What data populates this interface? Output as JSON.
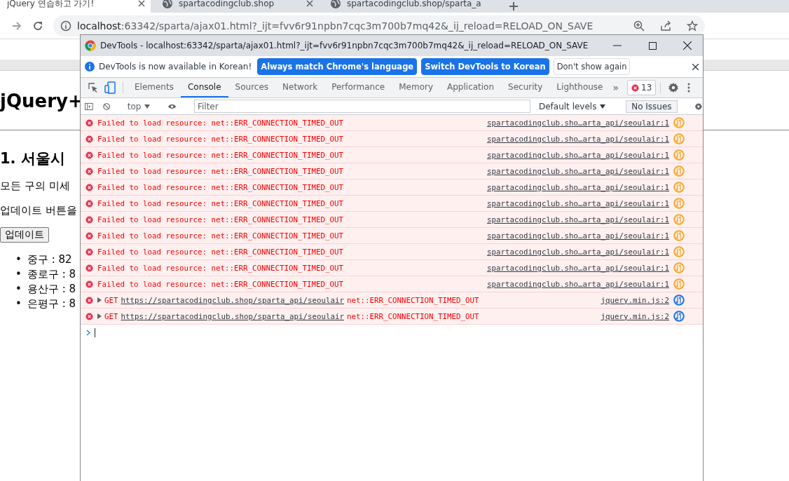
{
  "browser": {
    "tabs": [
      {
        "title": "jQuery 연습하고 가기!",
        "selected": true
      },
      {
        "title": "spartacodingclub.shop",
        "selected": false
      },
      {
        "title": "spartacodingclub.shop/sparta_a",
        "selected": false
      }
    ],
    "address": {
      "host": "localhost",
      "rest": ":63342/sparta/ajax01.html?_ijt=fvv6r91npbn7cqc3m700b7mq42&_ij_reload=RELOAD_ON_SAVE"
    }
  },
  "page": {
    "heading": "jQuery+",
    "subheading": "1. 서울시",
    "paragraphs": [
      "모든 구의 미세",
      "업데이트 버튼을"
    ],
    "button": "업데이트",
    "items": [
      {
        "marker": "•",
        "text": "중구 : 82"
      },
      {
        "marker": "•",
        "text": "종로구 : 8"
      },
      {
        "marker": "•",
        "text": "용산구 : 8"
      },
      {
        "marker": "•",
        "text": "은평구 : 8"
      }
    ]
  },
  "devtools": {
    "title": "DevTools - localhost:63342/sparta/ajax01.html?_ijt=fvv6r91npbn7cqc3m700b7mq42&_ij_reload=RELOAD_ON_SAVE",
    "infobar": {
      "message": "DevTools is now available in Korean!",
      "buttons": [
        {
          "label": "Always match Chrome's language",
          "kind": "primary"
        },
        {
          "label": "Switch DevTools to Korean",
          "kind": "primary"
        },
        {
          "label": "Don't show again",
          "kind": "secondary"
        }
      ]
    },
    "tabs": [
      {
        "label": "Elements",
        "selected": false
      },
      {
        "label": "Console",
        "selected": true
      },
      {
        "label": "Sources",
        "selected": false
      },
      {
        "label": "Network",
        "selected": false
      },
      {
        "label": "Performance",
        "selected": false
      },
      {
        "label": "Memory",
        "selected": false
      },
      {
        "label": "Application",
        "selected": false
      },
      {
        "label": "Security",
        "selected": false
      },
      {
        "label": "Lighthouse",
        "selected": false
      }
    ],
    "more_tabs": "»",
    "error_count": "13",
    "toolbar": {
      "context": "top",
      "filter_placeholder": "Filter",
      "levels": "Default levels",
      "issues": "No Issues"
    },
    "messages": [
      {
        "kind": "failed",
        "text": "Failed to load resource: net::ERR_CONNECTION_TIMED_OUT",
        "source": "spartacodingclub.sho…arta_api/seoulair:1",
        "color": "#f9a825"
      },
      {
        "kind": "failed",
        "text": "Failed to load resource: net::ERR_CONNECTION_TIMED_OUT",
        "source": "spartacodingclub.sho…arta_api/seoulair:1",
        "color": "#f9a825"
      },
      {
        "kind": "failed",
        "text": "Failed to load resource: net::ERR_CONNECTION_TIMED_OUT",
        "source": "spartacodingclub.sho…arta_api/seoulair:1",
        "color": "#f9a825"
      },
      {
        "kind": "failed",
        "text": "Failed to load resource: net::ERR_CONNECTION_TIMED_OUT",
        "source": "spartacodingclub.sho…arta_api/seoulair:1",
        "color": "#f9a825"
      },
      {
        "kind": "failed",
        "text": "Failed to load resource: net::ERR_CONNECTION_TIMED_OUT",
        "source": "spartacodingclub.sho…arta_api/seoulair:1",
        "color": "#f9a825"
      },
      {
        "kind": "failed",
        "text": "Failed to load resource: net::ERR_CONNECTION_TIMED_OUT",
        "source": "spartacodingclub.sho…arta_api/seoulair:1",
        "color": "#f9a825"
      },
      {
        "kind": "failed",
        "text": "Failed to load resource: net::ERR_CONNECTION_TIMED_OUT",
        "source": "spartacodingclub.sho…arta_api/seoulair:1",
        "color": "#f9a825"
      },
      {
        "kind": "failed",
        "text": "Failed to load resource: net::ERR_CONNECTION_TIMED_OUT",
        "source": "spartacodingclub.sho…arta_api/seoulair:1",
        "color": "#f9a825"
      },
      {
        "kind": "failed",
        "text": "Failed to load resource: net::ERR_CONNECTION_TIMED_OUT",
        "source": "spartacodingclub.sho…arta_api/seoulair:1",
        "color": "#f9a825"
      },
      {
        "kind": "failed",
        "text": "Failed to load resource: net::ERR_CONNECTION_TIMED_OUT",
        "source": "spartacodingclub.sho…arta_api/seoulair:1",
        "color": "#f9a825"
      },
      {
        "kind": "failed",
        "text": "Failed to load resource: net::ERR_CONNECTION_TIMED_OUT",
        "source": "spartacodingclub.sho…arta_api/seoulair:1",
        "color": "#f9a825"
      },
      {
        "kind": "request",
        "method": "GET",
        "url": "https://spartacodingclub.shop/sparta_api/seoulair",
        "text": "net::ERR_CONNECTION_TIMED_OUT",
        "source": "jquery.min.js:2",
        "color": "#1a73e8"
      },
      {
        "kind": "request",
        "method": "GET",
        "url": "https://spartacodingclub.shop/sparta_api/seoulair",
        "text": "net::ERR_CONNECTION_TIMED_OUT",
        "source": "jquery.min.js:2",
        "color": "#1a73e8"
      }
    ]
  }
}
